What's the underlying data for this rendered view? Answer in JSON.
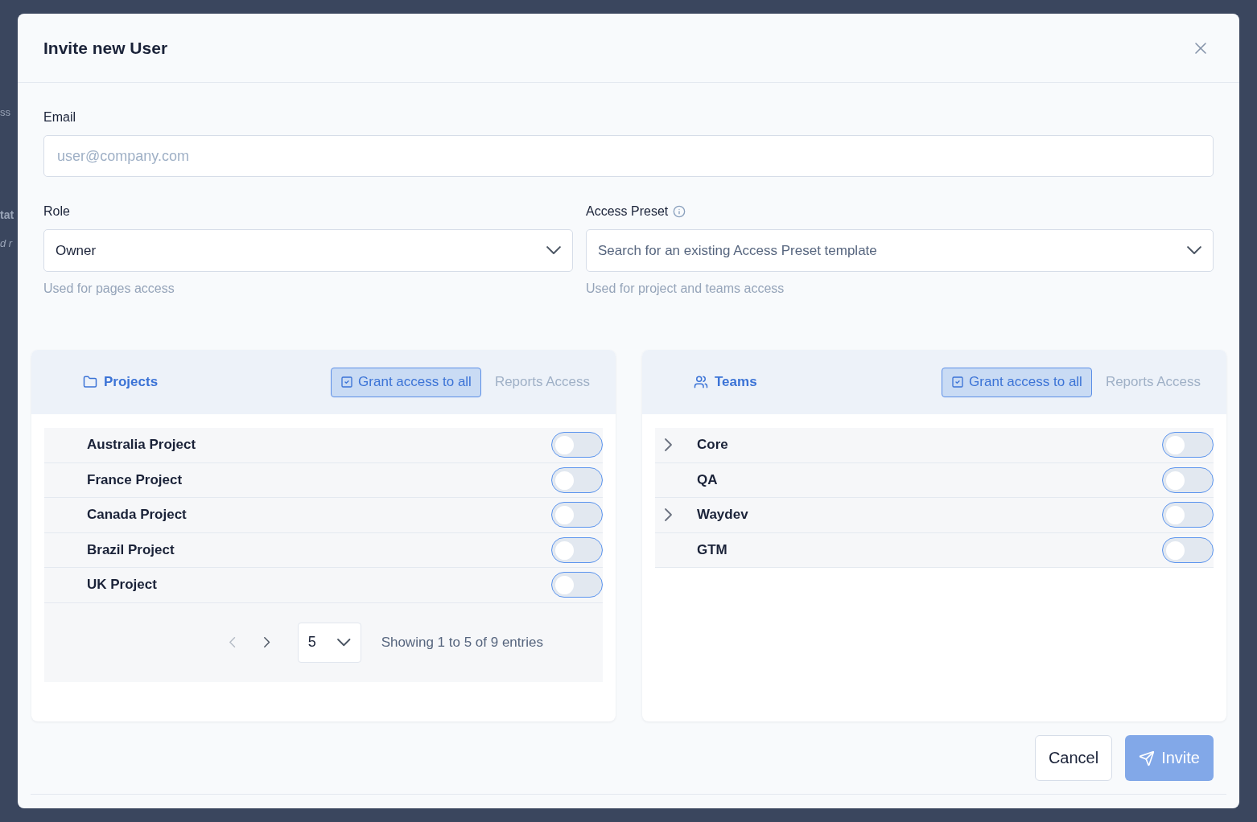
{
  "background_fragments": [
    {
      "text": "ss",
      "kind": "plain"
    },
    {
      "text": "tat",
      "kind": "bold"
    },
    {
      "text": "d r",
      "kind": "italic"
    }
  ],
  "dialog": {
    "title": "Invite new User"
  },
  "email": {
    "label": "Email",
    "placeholder": "user@company.com"
  },
  "role": {
    "label": "Role",
    "value": "Owner",
    "hint": "Used for pages access"
  },
  "access_preset": {
    "label": "Access Preset",
    "placeholder": "Search for an existing Access Preset template",
    "hint": "Used for project and teams access"
  },
  "panels": [
    {
      "kind": "projects",
      "title": "Projects",
      "grant_button": "Grant access to all",
      "reports_access": "Reports Access",
      "rows": [
        {
          "name": "Australia Project",
          "on": false
        },
        {
          "name": "France Project",
          "on": false
        },
        {
          "name": "Canada Project",
          "on": false
        },
        {
          "name": "Brazil Project",
          "on": false
        },
        {
          "name": "UK Project",
          "on": false
        }
      ],
      "pagination": {
        "prev_disabled": true,
        "next_disabled": false,
        "page_size": "5",
        "summary": "Showing 1 to 5 of 9 entries"
      }
    },
    {
      "kind": "teams",
      "title": "Teams",
      "grant_button": "Grant access to all",
      "reports_access": "Reports Access",
      "rows": [
        {
          "name": "Core",
          "on": false,
          "expandable": true
        },
        {
          "name": "QA",
          "on": false,
          "expandable": false
        },
        {
          "name": "Waydev",
          "on": false,
          "expandable": true
        },
        {
          "name": "GTM",
          "on": false,
          "expandable": false
        }
      ]
    }
  ],
  "actions": {
    "cancel": "Cancel",
    "invite": "Invite",
    "invite_disabled": true
  }
}
